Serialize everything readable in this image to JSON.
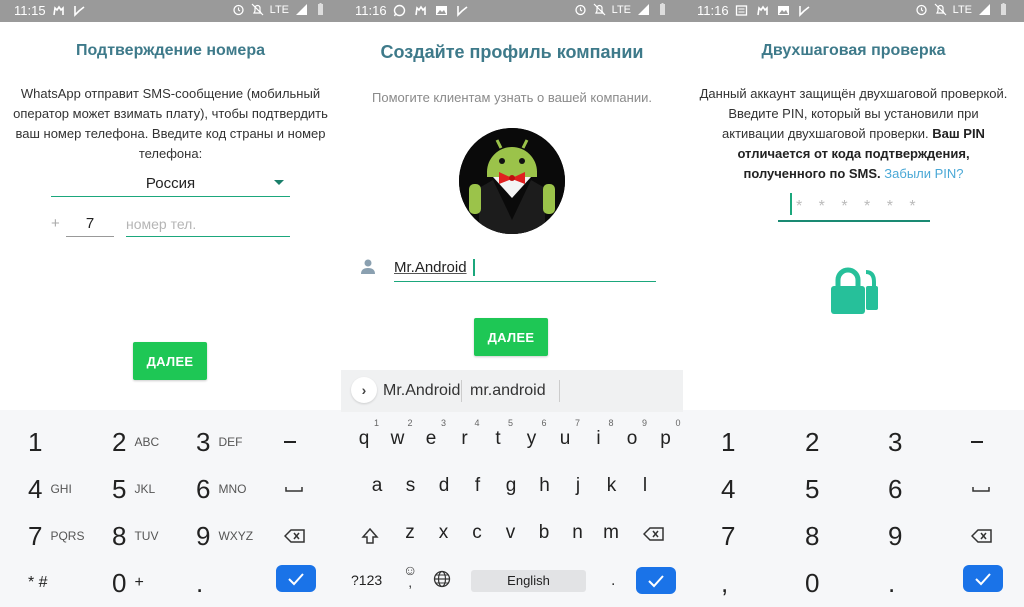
{
  "theme": {
    "accent": "#1ba77c",
    "title_color": "#3e7a8a",
    "button_green": "#1ec755",
    "keyboard_ok_blue": "#1a73e8",
    "link_color": "#4aa8d6",
    "statusbar_bg": "#9a9a9a"
  },
  "screens": [
    {
      "statusbar": {
        "time": "11:15",
        "left_icons": [
          "notification-app-icon",
          "download-done-icon"
        ],
        "right_icons": [
          "alarm-icon",
          "notifications-off-icon",
          "signal-icon",
          "battery-icon"
        ],
        "network": "LTE"
      },
      "title": "Подтверждение номера",
      "description": "WhatsApp отправит SMS-сообщение (мобильный оператор может взимать плату), чтобы подтвердить ваш номер телефона. Введите код страны и номер телефона:",
      "country_select": {
        "value": "Россия"
      },
      "country_code": {
        "prefix": "+",
        "value": "7"
      },
      "phone_input": {
        "value": "",
        "placeholder": "номер тел."
      },
      "next_button": "ДАЛЕЕ",
      "keyboard": {
        "type": "numeric-phone",
        "rows": [
          [
            {
              "d": "1",
              "l": ""
            },
            {
              "d": "2",
              "l": "ABC"
            },
            {
              "d": "3",
              "l": "DEF"
            },
            {
              "d": "–",
              "l": ""
            }
          ],
          [
            {
              "d": "4",
              "l": "GHI"
            },
            {
              "d": "5",
              "l": "JKL"
            },
            {
              "d": "6",
              "l": "MNO"
            },
            {
              "d": "␣",
              "l": ""
            }
          ],
          [
            {
              "d": "7",
              "l": "PQRS"
            },
            {
              "d": "8",
              "l": "TUV"
            },
            {
              "d": "9",
              "l": "WXYZ"
            },
            {
              "d": "⌫",
              "l": ""
            }
          ],
          [
            {
              "d": "* #",
              "l": ""
            },
            {
              "d": "0",
              "l": "+"
            },
            {
              "d": ".",
              "l": ""
            },
            {
              "d": "✓",
              "l": ""
            }
          ]
        ]
      }
    },
    {
      "statusbar": {
        "time": "11:16",
        "left_icons": [
          "whatsapp-icon",
          "notification-app-icon",
          "image-icon",
          "download-done-icon"
        ],
        "right_icons": [
          "alarm-icon",
          "notifications-off-icon",
          "signal-icon",
          "battery-icon"
        ],
        "network": "LTE"
      },
      "title": "Создайте профиль компании",
      "subtitle": "Помогите клиентам узнать о вашей компании.",
      "avatar": "android-tuxedo-avatar",
      "name_input": {
        "value": "Mr.Android"
      },
      "next_button": "ДАЛЕЕ",
      "suggestions": [
        "Mr.Android",
        "mr.android"
      ],
      "keyboard": {
        "type": "qwerty",
        "row1": [
          {
            "k": "q",
            "n": "1"
          },
          {
            "k": "w",
            "n": "2"
          },
          {
            "k": "e",
            "n": "3"
          },
          {
            "k": "r",
            "n": "4"
          },
          {
            "k": "t",
            "n": "5"
          },
          {
            "k": "y",
            "n": "6"
          },
          {
            "k": "u",
            "n": "7"
          },
          {
            "k": "i",
            "n": "8"
          },
          {
            "k": "o",
            "n": "9"
          },
          {
            "k": "p",
            "n": "0"
          }
        ],
        "row2": [
          "a",
          "s",
          "d",
          "f",
          "g",
          "h",
          "j",
          "k",
          "l"
        ],
        "row3": [
          "z",
          "x",
          "c",
          "v",
          "b",
          "n",
          "m"
        ],
        "symbols_key": "?123",
        "space_label": "English",
        "period": "."
      }
    },
    {
      "statusbar": {
        "time": "11:16",
        "left_icons": [
          "message-icon",
          "notification-app-icon",
          "image-icon",
          "download-done-icon"
        ],
        "right_icons": [
          "alarm-icon",
          "notifications-off-icon",
          "signal-icon",
          "battery-icon"
        ],
        "network": "LTE"
      },
      "title": "Двухшаговая проверка",
      "description_plain": "Данный аккаунт защищён двухшаговой проверкой. Введите PIN, который вы установили при активации двухшаговой проверки. ",
      "description_bold": "Ваш PIN отличается от кода подтверждения, полученного по SMS.",
      "forgot_link": "Забыли PIN?",
      "pin_input": {
        "mask": "* * *  * * *"
      },
      "keyboard": {
        "type": "numeric",
        "rows": [
          [
            "1",
            "2",
            "3",
            "–"
          ],
          [
            "4",
            "5",
            "6",
            "␣"
          ],
          [
            "7",
            "8",
            "9",
            "⌫"
          ],
          [
            ",",
            "0",
            ".",
            "✓"
          ]
        ]
      }
    }
  ]
}
